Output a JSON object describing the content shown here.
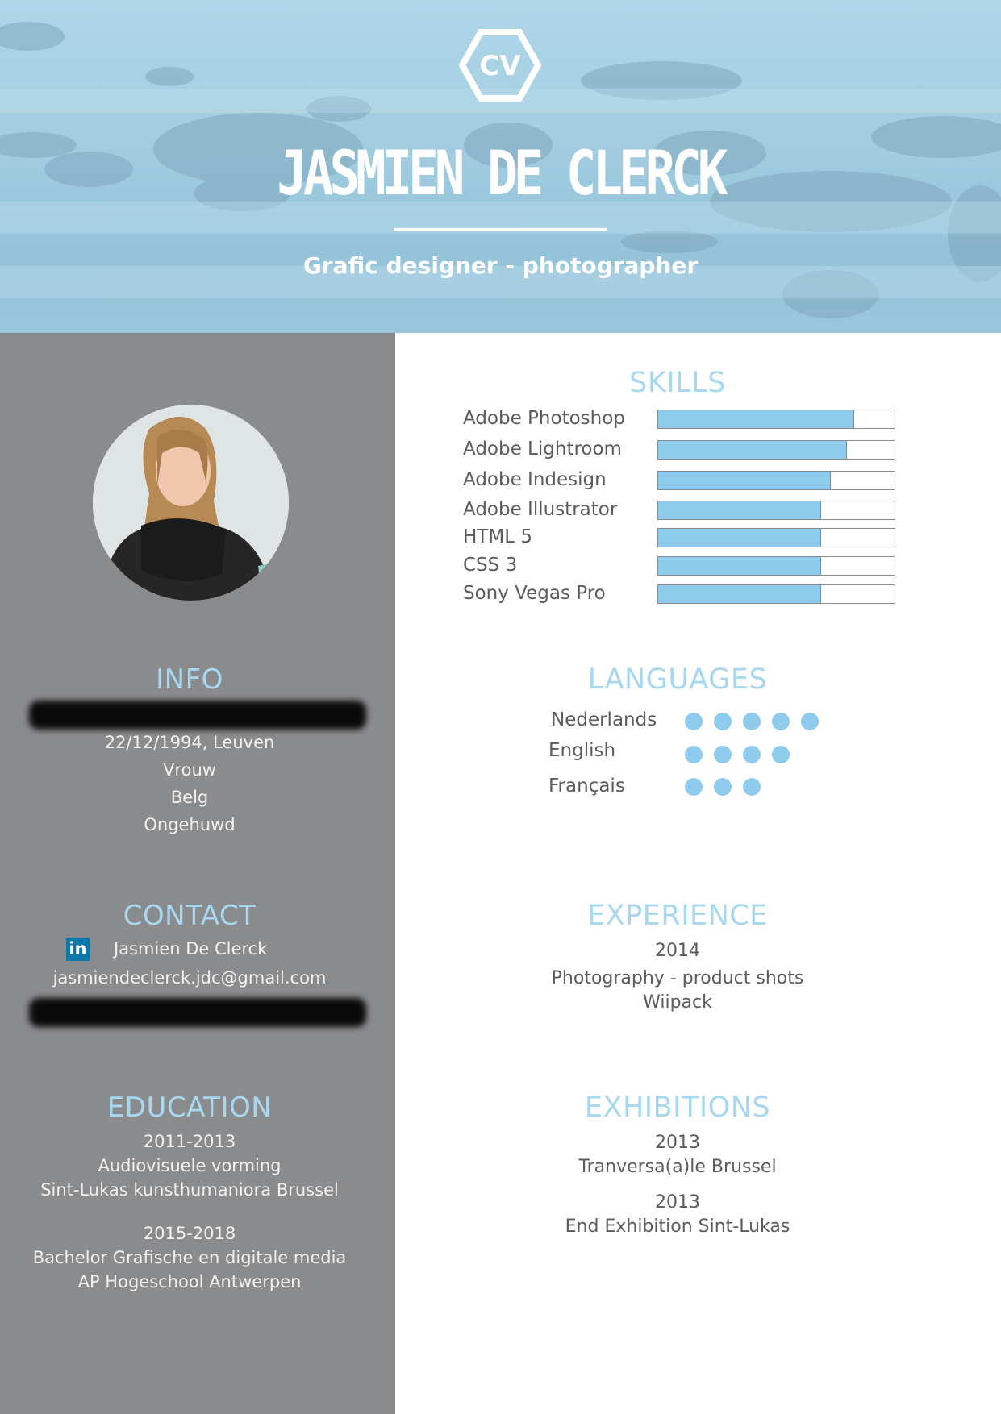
{
  "header": {
    "badge": "CV",
    "name": "JASMIEN DE CLERCK",
    "subtitle": "Grafic designer - photographer"
  },
  "colors": {
    "accent": "#a8d8ef",
    "bar_fill": "#8fcbec",
    "sidebar": "#8a8b8d",
    "linkedin": "#0e76a8"
  },
  "info": {
    "title": "INFO",
    "birth": "22/12/1994, Leuven",
    "gender": "Vrouw",
    "nationality": "Belg",
    "status": "Ongehuwd"
  },
  "contact": {
    "title": "CONTACT",
    "linkedin_icon": "linkedin-icon",
    "linkedin_label": "in",
    "linkedin_name": "Jasmien De Clerck",
    "email": "jasmiendeclerck.jdc@gmail.com"
  },
  "education": {
    "title": "EDUCATION",
    "entries": [
      {
        "years": "2011-2013",
        "program": "Audiovisuele vorming",
        "school": "Sint-Lukas kunsthumaniora Brussel"
      },
      {
        "years": "2015-2018",
        "program": "Bachelor Grafische en digitale media",
        "school": "AP Hogeschool Antwerpen"
      }
    ]
  },
  "skills": {
    "title": "SKILLS",
    "items": [
      {
        "label": "Adobe Photoshop",
        "level": 0.83
      },
      {
        "label": "Adobe Lightroom",
        "level": 0.8
      },
      {
        "label": "Adobe Indesign",
        "level": 0.73
      },
      {
        "label": "Adobe Illustrator",
        "level": 0.69
      },
      {
        "label": "HTML 5",
        "level": 0.69
      },
      {
        "label": "CSS 3",
        "level": 0.69
      },
      {
        "label": "Sony Vegas Pro",
        "level": 0.69
      }
    ]
  },
  "languages": {
    "title": "LANGUAGES",
    "items": [
      {
        "label": "Nederlands",
        "dots": 5
      },
      {
        "label": "English",
        "dots": 4
      },
      {
        "label": "Français",
        "dots": 3
      }
    ]
  },
  "experience": {
    "title": "EXPERIENCE",
    "year": "2014",
    "role": "Photography -  product shots",
    "company": "Wiipack"
  },
  "exhibitions": {
    "title": "EXHIBITIONS",
    "entries": [
      {
        "year": "2013",
        "name": "Tranversa(a)le Brussel"
      },
      {
        "year": "2013",
        "name": "End Exhibition Sint-Lukas"
      }
    ]
  }
}
